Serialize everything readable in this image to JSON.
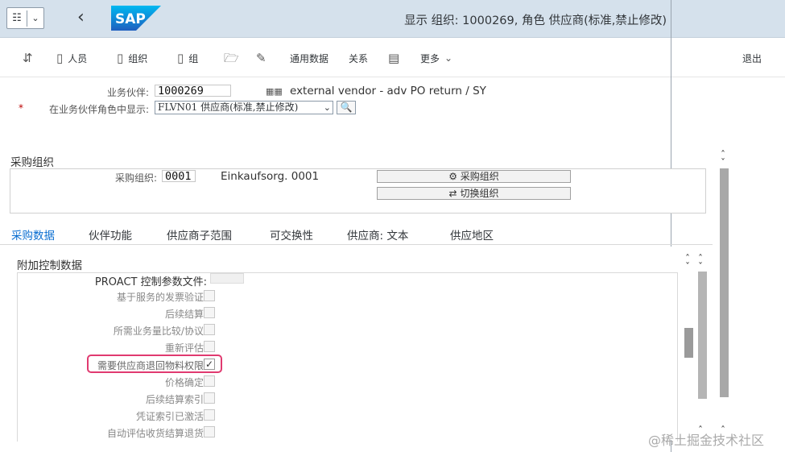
{
  "titlebar": {
    "title": "显示 组织: 1000269, 角色 供应商(标准,禁止修改)",
    "logo_text": "SAP"
  },
  "toolbar": {
    "items": [
      {
        "label": "",
        "icon": "switch-arrows-icon"
      },
      {
        "label": "人员",
        "icon": "document-icon"
      },
      {
        "label": "组织",
        "icon": "document-icon"
      },
      {
        "label": "组",
        "icon": "document-icon"
      },
      {
        "label": "",
        "icon": "folder-open-icon"
      },
      {
        "label": "",
        "icon": "pen-icon"
      },
      {
        "label": "通用数据",
        "icon": ""
      },
      {
        "label": "关系",
        "icon": ""
      },
      {
        "label": "",
        "icon": "hierarchy-icon"
      },
      {
        "label": "更多",
        "icon": "chevron-down-icon"
      }
    ],
    "exit_label": "退出"
  },
  "header": {
    "bp_label": "业务伙伴:",
    "bp_value": "1000269",
    "bp_description": "external vendor - adv PO return / SY",
    "role_label": "在业务伙伴角色中显示:",
    "role_value": "FLVN01 供应商(标准,禁止修改)",
    "required_mark": "*"
  },
  "purch_org": {
    "section_title": "采购组织",
    "org_label": "采购组织:",
    "org_value": "0001",
    "org_description": "Einkaufsorg. 0001",
    "button_purch_org": "采购组织",
    "button_switch_org": "切换组织"
  },
  "tabs": [
    {
      "label": "采购数据",
      "active": true
    },
    {
      "label": "伙伴功能",
      "active": false
    },
    {
      "label": "供应商子范围",
      "active": false
    },
    {
      "label": "可交换性",
      "active": false
    },
    {
      "label": "供应商: 文本",
      "active": false
    },
    {
      "label": "供应地区",
      "active": false
    }
  ],
  "panel": {
    "title": "附加控制数据",
    "proact_label": "PROACT 控制参数文件:",
    "fields": [
      {
        "label": "基于服务的发票验证:",
        "checked": false
      },
      {
        "label": "后续结算:",
        "checked": false
      },
      {
        "label": "所需业务量比较/协议:",
        "checked": false
      },
      {
        "label": "重新评估:",
        "checked": false
      },
      {
        "label": "需要供应商退回物料权限:",
        "checked": true
      },
      {
        "label": "价格确定:",
        "checked": false
      },
      {
        "label": "后续结算索引:",
        "checked": false
      },
      {
        "label": "凭证索引已激活:",
        "checked": false
      },
      {
        "label": "自动评估收货结算退货:",
        "checked": false
      }
    ]
  },
  "watermark": "@稀土掘金技术社区"
}
